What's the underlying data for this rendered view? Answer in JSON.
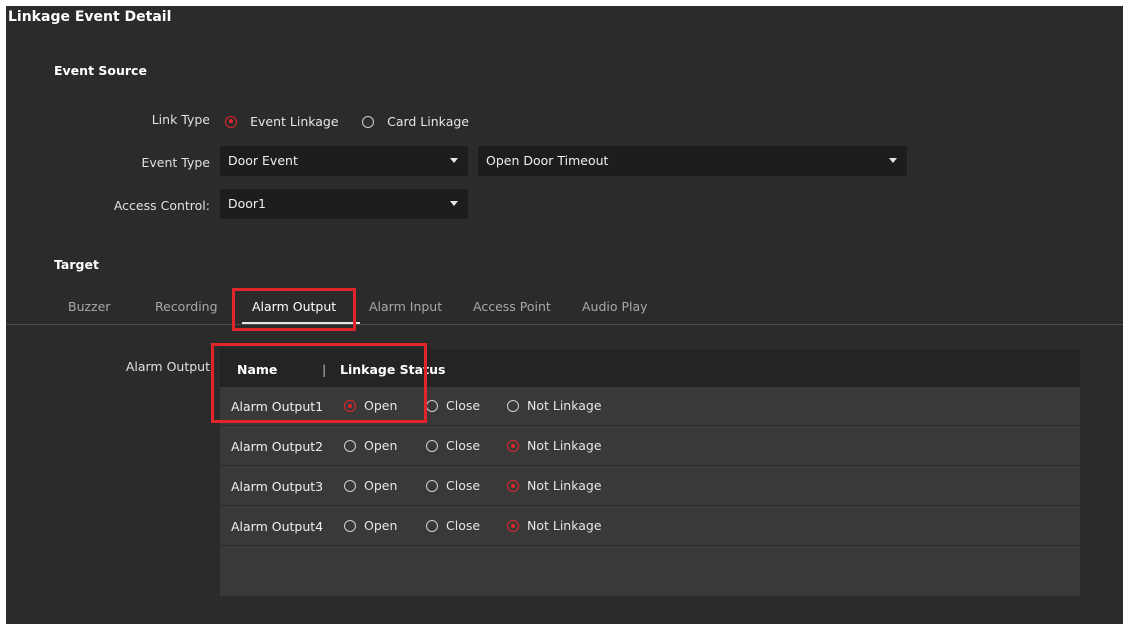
{
  "window": {
    "title": "Linkage Event Detail"
  },
  "event_source": {
    "heading": "Event Source",
    "link_type": {
      "label": "Link Type",
      "options": [
        {
          "label": "Event Linkage",
          "selected": true
        },
        {
          "label": "Card Linkage",
          "selected": false
        }
      ]
    },
    "event_type": {
      "label": "Event Type",
      "primary": "Door Event",
      "secondary": "Open Door Timeout"
    },
    "access_control": {
      "label": "Access Control:",
      "value": "Door1"
    }
  },
  "target": {
    "heading": "Target",
    "tabs": [
      {
        "label": "Buzzer",
        "active": false
      },
      {
        "label": "Recording",
        "active": false
      },
      {
        "label": "Alarm Output",
        "active": true
      },
      {
        "label": "Alarm Input",
        "active": false
      },
      {
        "label": "Access Point",
        "active": false
      },
      {
        "label": "Audio Play",
        "active": false
      }
    ],
    "alarm_output": {
      "label": "Alarm Output",
      "columns": {
        "name": "Name",
        "separator": "|",
        "status": "Linkage Status"
      },
      "status_options": [
        "Open",
        "Close",
        "Not Linkage"
      ],
      "rows": [
        {
          "name": "Alarm Output1",
          "selected": "Open"
        },
        {
          "name": "Alarm Output2",
          "selected": "Not Linkage"
        },
        {
          "name": "Alarm Output3",
          "selected": "Not Linkage"
        },
        {
          "name": "Alarm Output4",
          "selected": "Not Linkage"
        }
      ]
    }
  },
  "colors": {
    "background": "#2b2b2b",
    "field": "#1d1d1d",
    "accent_red": "#e0262b",
    "grid": "#393939",
    "grid_header": "#242424"
  }
}
